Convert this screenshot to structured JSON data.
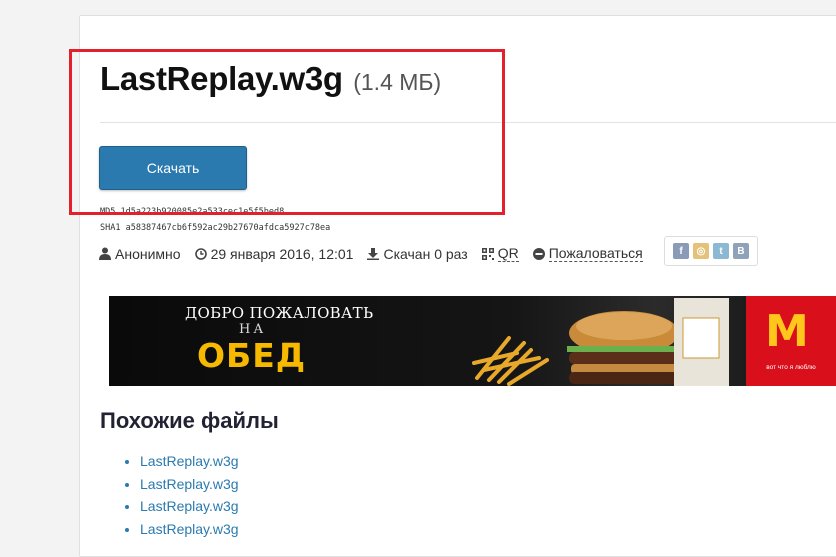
{
  "file": {
    "name": "LastReplay.w3g",
    "size": "(1.4 МБ)",
    "download_label": "Скачать",
    "md5": "MD5  1d5a223b920085e2a533cec1e5f5bed8",
    "sha1": "SHA1 a58387467cb6f592ac29b27670afdca5927c78ea"
  },
  "meta": {
    "author": "Анонимно",
    "date": "29 января 2016, 12:01",
    "downloads": "Скачан 0 раз",
    "qr": "QR",
    "report": "Пожаловаться"
  },
  "share_icons": [
    "facebook-icon",
    "odnoklassniki-icon",
    "twitter-icon",
    "vkontakte-icon"
  ],
  "banner": {
    "line1": "ДОБРО ПОЖАЛОВАТЬ",
    "line2": "НА",
    "line3": "ОБЕД",
    "brand_slogan": "вот что я люблю"
  },
  "similar": {
    "heading": "Похожие файлы",
    "items": [
      "LastReplay.w3g",
      "LastReplay.w3g",
      "LastReplay.w3g",
      "LastReplay.w3g"
    ]
  },
  "colors": {
    "accent": "#2a7ab0",
    "highlight_box": "#e3202c"
  }
}
